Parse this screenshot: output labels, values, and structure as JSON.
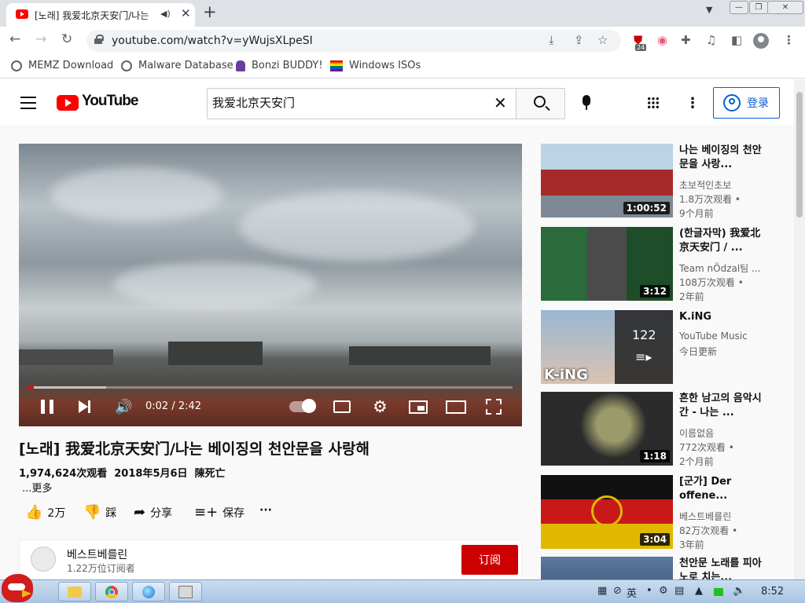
{
  "browser": {
    "tab_title": "[노래] 我爱北京天安门/나는",
    "url": "youtube.com/watch?v=yWujsXLpeSI",
    "extension_badge": "24",
    "bookmarks": [
      "MEMZ Download",
      "Malware Database",
      "Bonzi BUDDY!",
      "Windows ISOs"
    ]
  },
  "youtube": {
    "logo_text": "YouTube",
    "search_value": "我爱北京天安门",
    "signin_label": "登录",
    "player": {
      "time_current": "0:02",
      "time_total": "2:42",
      "time_separator": "/",
      "progress_fraction": 0.012,
      "buffered_fraction": 0.16
    },
    "video": {
      "title": "[노래] 我爱北京天安门/나는 베이징의 천안문을 사랑해",
      "views": "1,974,624次观看",
      "date": "2018年5月6日",
      "author_tag": "陳死亡",
      "more": "...更多"
    },
    "actions": {
      "like_count": "2万",
      "dislike_label": "踩",
      "share_label": "分享",
      "save_label": "保存"
    },
    "channel": {
      "name": "베스트베를린",
      "subs": "1.22万位订阅者",
      "subscribe_label": "订阅"
    },
    "recommendations": [
      {
        "title": "나는 베이징의 천안문을 사랑...",
        "channel": "초보적인초보",
        "views": "1.8万次观看 •",
        "age": "9个月前",
        "duration": "1:00:52"
      },
      {
        "title": "(한글자막) 我爱北京天安门 / ...",
        "channel": "Team nÖdzal팀 ...",
        "views": "108万次观看 •",
        "age": "2年前",
        "duration": "3:12"
      },
      {
        "title": "K.iNG",
        "channel": "YouTube Music",
        "views": "今日更新",
        "age": "",
        "duration": "",
        "playlist_count": "122",
        "thumb_text": "K-iNG"
      },
      {
        "title": "흔한 남고의 음악시간 - 나는 ...",
        "channel": "이름없음",
        "views": "772次观看 •",
        "age": "2个月前",
        "duration": "1:18"
      },
      {
        "title": "[군가] Der offene...",
        "channel": "베스트베를린",
        "views": "82万次观看 •",
        "age": "3年前",
        "duration": "3:04"
      },
      {
        "title": "천안문 노래를 피아노로 치는...",
        "channel": "",
        "views": "",
        "age": "",
        "duration": ""
      }
    ]
  },
  "taskbar": {
    "ime_label": "英",
    "clock": "8:52"
  },
  "colors": {
    "yt_red": "#ff0000",
    "link_blue": "#065fd4",
    "subscribe_red": "#cc0000"
  }
}
